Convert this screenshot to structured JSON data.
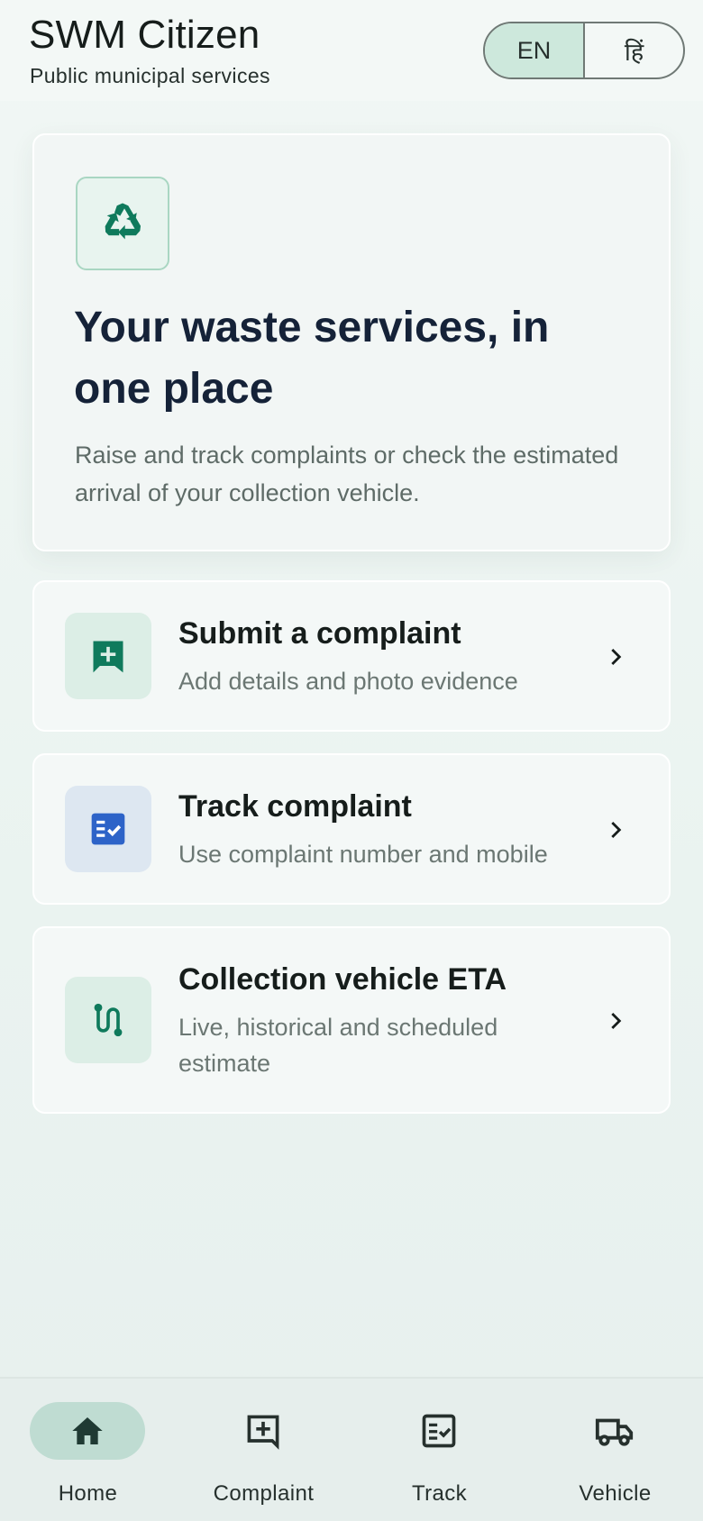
{
  "header": {
    "title": "SWM Citizen",
    "subtitle": "Public municipal services",
    "languages": [
      {
        "label": "EN",
        "selected": true
      },
      {
        "label": "हिं",
        "selected": false
      }
    ]
  },
  "hero": {
    "icon": "recycle-icon",
    "title": "Your waste services, in one place",
    "body": "Raise and track complaints or check the estimated arrival of your collection vehicle."
  },
  "actions": [
    {
      "icon": "add-comment-icon",
      "title": "Submit a complaint",
      "subtitle": "Add details and photo evidence",
      "icon_color": "#0f7a5c",
      "icon_bg": "#dceee6"
    },
    {
      "icon": "checklist-icon",
      "title": "Track complaint",
      "subtitle": "Use complaint number and mobile",
      "icon_color": "#2d63c8",
      "icon_bg": "#dde7f1"
    },
    {
      "icon": "route-icon",
      "title": "Collection vehicle ETA",
      "subtitle": "Live, historical and scheduled estimate",
      "icon_color": "#0f7a5c",
      "icon_bg": "#dceee6"
    }
  ],
  "bottom_nav": [
    {
      "label": "Home",
      "icon": "home-icon",
      "selected": true
    },
    {
      "label": "Complaint",
      "icon": "add-comment-outline-icon",
      "selected": false
    },
    {
      "label": "Track",
      "icon": "checklist-outline-icon",
      "selected": false
    },
    {
      "label": "Vehicle",
      "icon": "truck-icon",
      "selected": false
    }
  ],
  "colors": {
    "accent": "#0f7a5c",
    "track_accent": "#2d63c8",
    "nav_selected_pill": "#bfdcd2",
    "lang_selected": "#cde8dc"
  }
}
